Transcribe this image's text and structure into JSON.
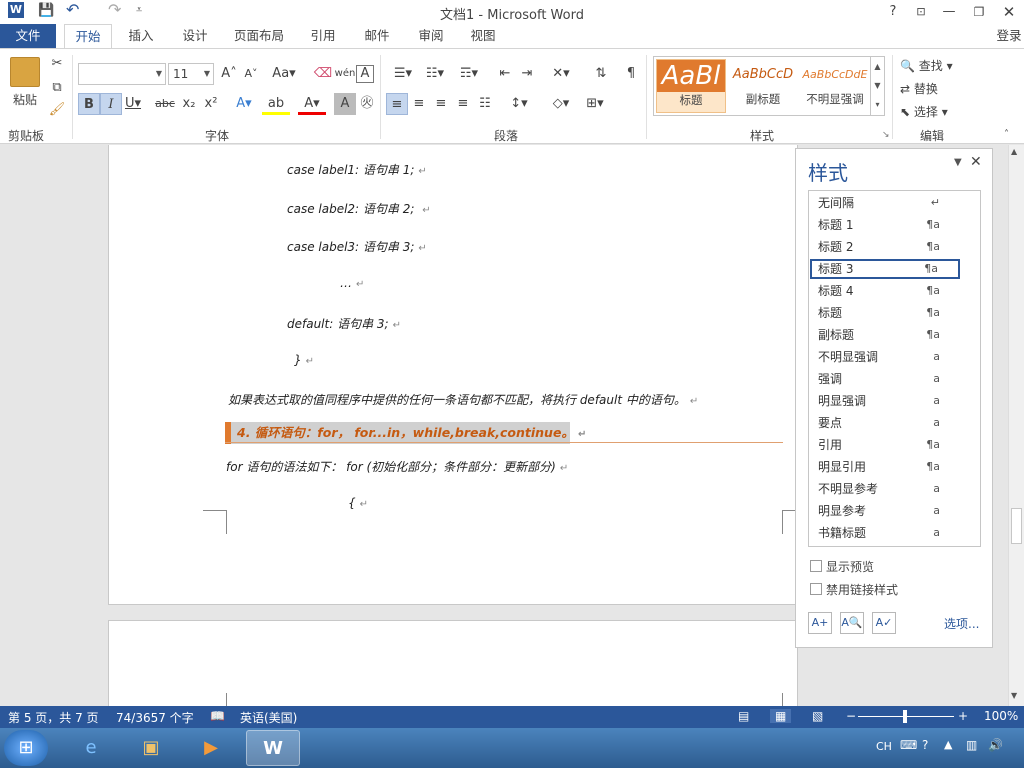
{
  "window": {
    "title": "文档1 - Microsoft Word",
    "help": "?",
    "login": "登录"
  },
  "qat": {
    "word_icon": "W",
    "save": "💾",
    "undo": "↶",
    "redo": "↷",
    "customize": "⩡"
  },
  "tabs": [
    {
      "label": "文件"
    },
    {
      "label": "开始"
    },
    {
      "label": "插入"
    },
    {
      "label": "设计"
    },
    {
      "label": "页面布局"
    },
    {
      "label": "引用"
    },
    {
      "label": "邮件"
    },
    {
      "label": "审阅"
    },
    {
      "label": "视图"
    }
  ],
  "ribbon": {
    "clipboard": {
      "paste": "粘贴",
      "group": "剪贴板"
    },
    "font": {
      "name": "",
      "size": "11",
      "group": "字体"
    },
    "paragraph": {
      "group": "段落"
    },
    "styles": {
      "group": "样式",
      "gallery": [
        {
          "sample": "AaBl",
          "name": "标题"
        },
        {
          "sample": "AaBbCcD",
          "name": "副标题"
        },
        {
          "sample": "AaBbCcDdE",
          "name": "不明显强调"
        }
      ]
    },
    "editing": {
      "find": "查找",
      "replace": "替换",
      "select": "选择",
      "group": "编辑"
    }
  },
  "document": {
    "lines": [
      "case label1: 语句串 1;",
      "case label2: 语句串 2; ",
      "case label3: 语句串 3;",
      "…",
      "default: 语句串 3;",
      "}",
      "如果表达式取的值同程序中提供的任何一条语句都不匹配，将执行 default  中的语句。",
      "4. 循环语句：for， for...in，while,break,continue。",
      "for 语句的语法如下： for (初始化部分；条件部分：更新部分)",
      "{"
    ],
    "para_mark": "↵"
  },
  "styles_pane": {
    "title": "样式",
    "items": [
      {
        "name": "无间隔",
        "mark": "↵"
      },
      {
        "name": "标题 1",
        "mark": "¶a"
      },
      {
        "name": "标题 2",
        "mark": "¶a"
      },
      {
        "name": "标题 3",
        "mark": "¶a"
      },
      {
        "name": "标题 4",
        "mark": "¶a"
      },
      {
        "name": "标题",
        "mark": "¶a"
      },
      {
        "name": "副标题",
        "mark": "¶a"
      },
      {
        "name": "不明显强调",
        "mark": "a"
      },
      {
        "name": "强调",
        "mark": "a"
      },
      {
        "name": "明显强调",
        "mark": "a"
      },
      {
        "name": "要点",
        "mark": "a"
      },
      {
        "name": "引用",
        "mark": "¶a"
      },
      {
        "name": "明显引用",
        "mark": "¶a"
      },
      {
        "name": "不明显参考",
        "mark": "a"
      },
      {
        "name": "明显参考",
        "mark": "a"
      },
      {
        "name": "书籍标题",
        "mark": "a"
      }
    ],
    "show_preview": "显示预览",
    "disable_linked": "禁用链接样式",
    "options": "选项..."
  },
  "status": {
    "page": "第 5 页，共 7 页",
    "words": "74/3657 个字",
    "language": "英语(美国)",
    "zoom": "100%"
  },
  "taskbar": {
    "ime": "CH"
  },
  "colors": {
    "accent": "#2b579a",
    "heading": "#c55a11",
    "heading_bar": "#e07a2e"
  }
}
